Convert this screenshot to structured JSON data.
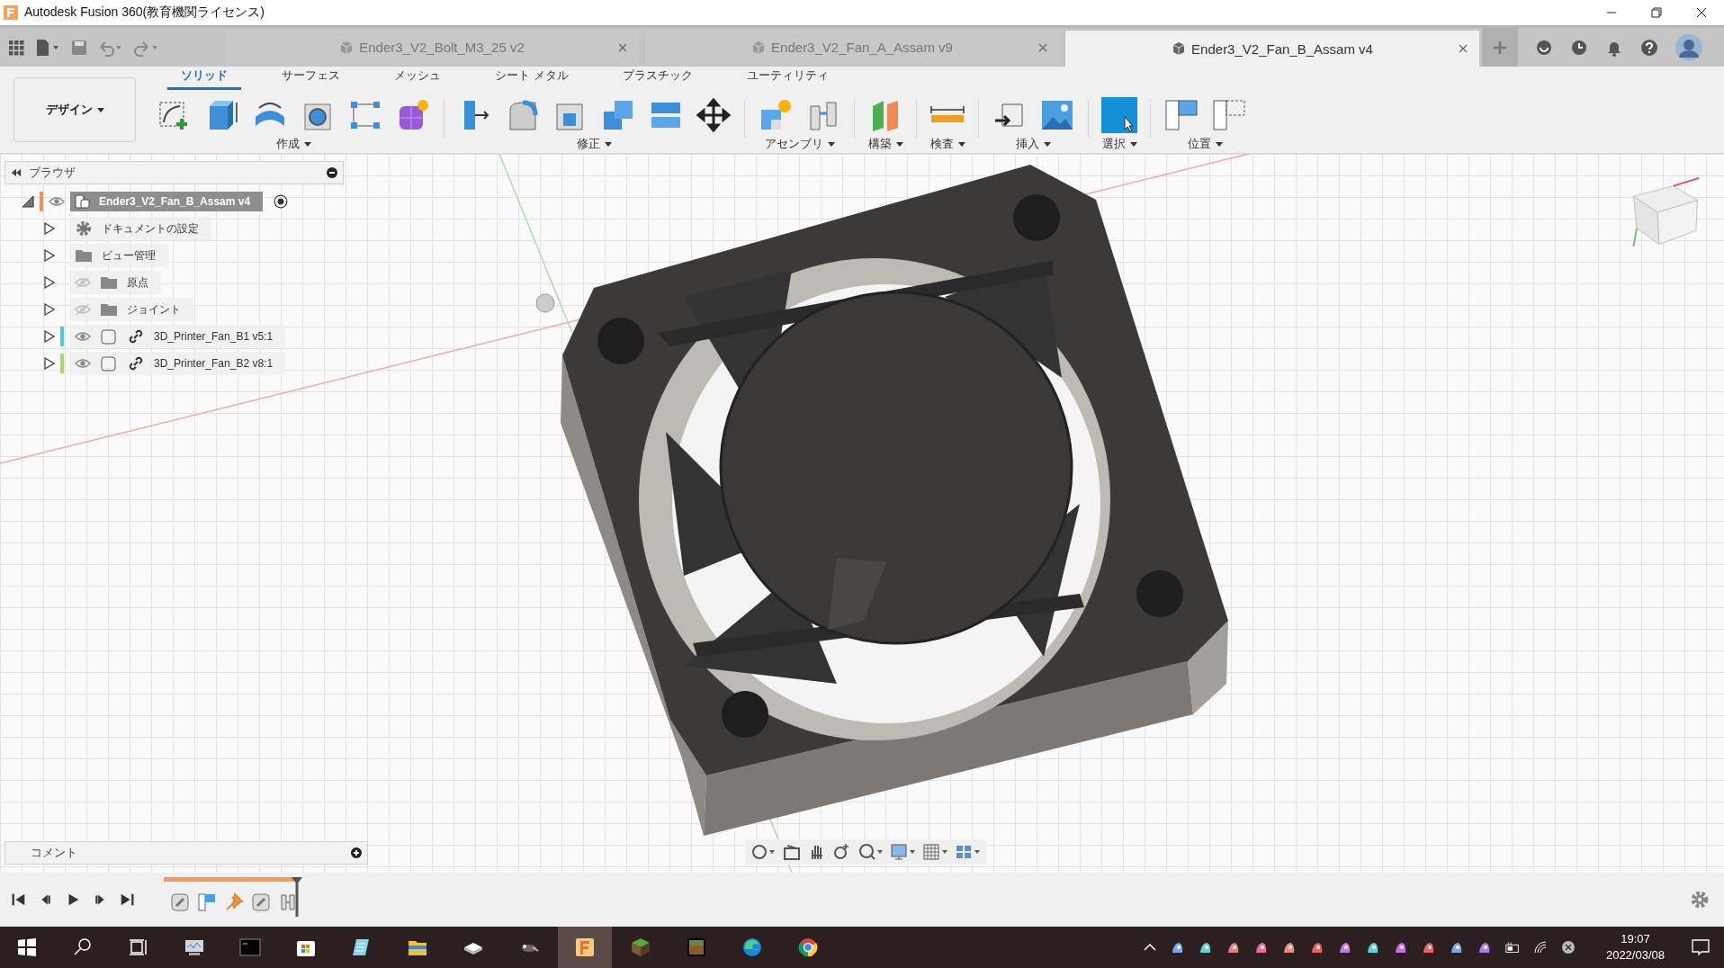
{
  "window": {
    "title": "Autodesk Fusion 360(教育機関ライセンス)"
  },
  "document_tabs": [
    {
      "label": "Ender3_V2_Bolt_M3_25 v2",
      "selected": false
    },
    {
      "label": "Ender3_V2_Fan_A_Assam v9",
      "selected": false
    },
    {
      "label": "Ender3_V2_Fan_B_Assam v4",
      "selected": true
    }
  ],
  "toolbar": {
    "workspace": "デザイン",
    "tabs": [
      {
        "label": "ソリッド",
        "selected": true
      },
      {
        "label": "サーフェス",
        "selected": false
      },
      {
        "label": "メッシュ",
        "selected": false
      },
      {
        "label": "シート メタル",
        "selected": false
      },
      {
        "label": "プラスチック",
        "selected": false
      },
      {
        "label": "ユーティリティ",
        "selected": false
      }
    ],
    "groups": [
      {
        "label": "作成",
        "tools": [
          {
            "kind": "sketch"
          },
          {
            "kind": "extrude"
          },
          {
            "kind": "revolve"
          },
          {
            "kind": "hole"
          },
          {
            "kind": "pattern"
          },
          {
            "kind": "form"
          }
        ]
      },
      {
        "label": "修正",
        "tools": [
          {
            "kind": "press-pull"
          },
          {
            "kind": "fillet"
          },
          {
            "kind": "shell"
          },
          {
            "kind": "combine"
          },
          {
            "kind": "offset"
          },
          {
            "kind": "move"
          }
        ]
      },
      {
        "label": "アセンブリ",
        "tools": [
          {
            "kind": "new-component"
          },
          {
            "kind": "joint"
          }
        ]
      },
      {
        "label": "構築",
        "tools": [
          {
            "kind": "plane"
          }
        ]
      },
      {
        "label": "検査",
        "tools": [
          {
            "kind": "measure"
          }
        ]
      },
      {
        "label": "挿入",
        "tools": [
          {
            "kind": "insert"
          },
          {
            "kind": "canvas"
          }
        ]
      },
      {
        "label": "選択",
        "tools": [
          {
            "kind": "select"
          }
        ]
      },
      {
        "label": "位置",
        "tools": [
          {
            "kind": "capture"
          },
          {
            "kind": "revert"
          }
        ]
      }
    ]
  },
  "browser": {
    "title": "ブラウザ",
    "root": {
      "label": "Ender3_V2_Fan_B_Assam v4",
      "visible": true,
      "selected": true,
      "color": "#f0955a"
    },
    "items": [
      {
        "label": "ドキュメントの設定",
        "kind": "settings",
        "selected": false
      },
      {
        "label": "ビュー管理",
        "kind": "folder",
        "selected": false
      },
      {
        "label": "原点",
        "kind": "folder",
        "visible": false,
        "selected": false
      },
      {
        "label": "ジョイント",
        "kind": "folder",
        "visible": false,
        "selected": false
      },
      {
        "label": "3D_Printer_Fan_B1 v5:1",
        "kind": "component",
        "visible": true,
        "selected": false,
        "color": "#4ec9d8"
      },
      {
        "label": "3D_Printer_Fan_B2 v8:1",
        "kind": "component",
        "visible": true,
        "selected": false,
        "color": "#a6d86a"
      }
    ]
  },
  "comments": {
    "title": "コメント"
  },
  "timeline": {
    "features": [
      {
        "kind": "joint"
      },
      {
        "kind": "plane"
      },
      {
        "kind": "pin"
      },
      {
        "kind": "joint"
      },
      {
        "kind": "motion"
      }
    ]
  },
  "taskbar": {
    "time": "19:07",
    "date": "2022/03/08"
  }
}
